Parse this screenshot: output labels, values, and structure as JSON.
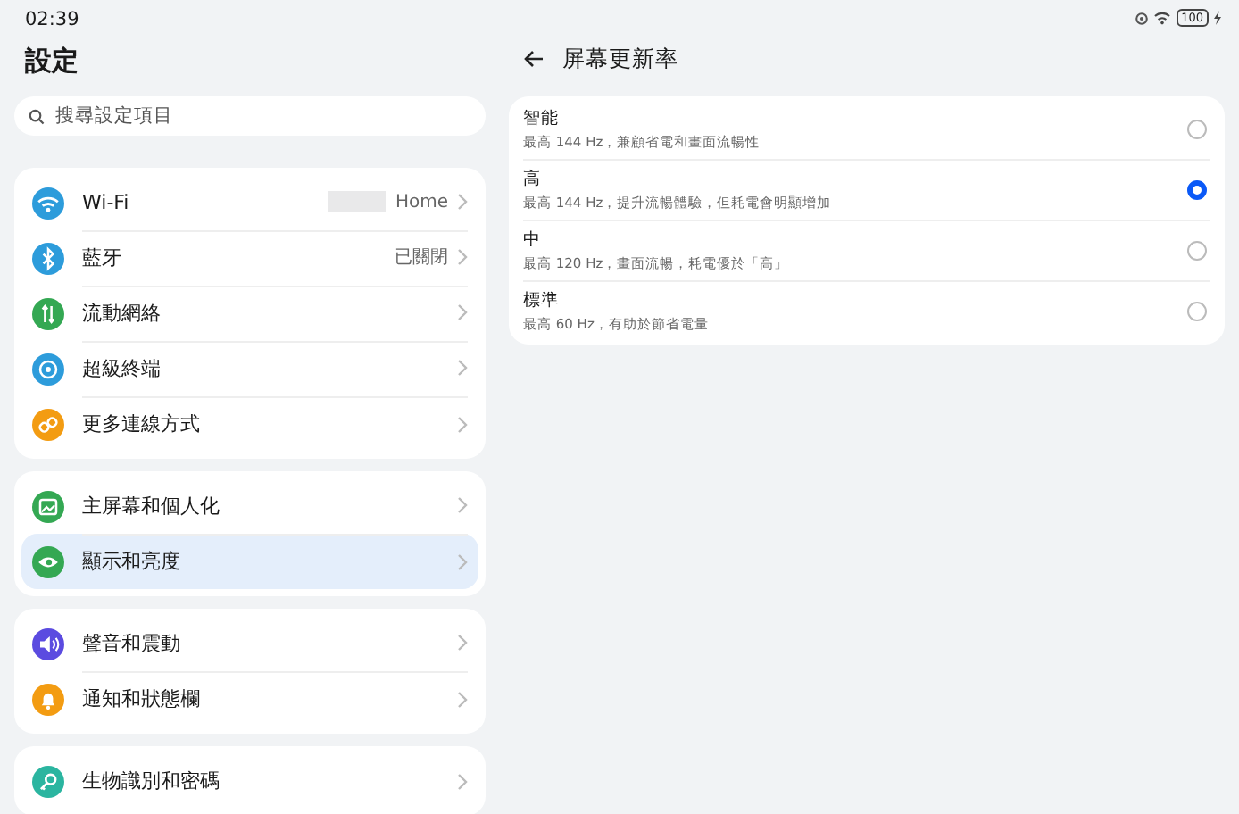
{
  "status_bar": {
    "time": "02:39",
    "battery": "100"
  },
  "sidebar": {
    "title": "設定",
    "search": {
      "placeholder": "搜尋設定項目"
    },
    "groups": [
      {
        "items": [
          {
            "kind": "wifi",
            "label": "Wi-Fi",
            "value": "Home",
            "redacted": true,
            "selected": false
          },
          {
            "kind": "bluetooth",
            "label": "藍牙",
            "value": "已關閉",
            "redacted": false,
            "selected": false
          },
          {
            "kind": "mobile",
            "label": "流動網絡",
            "selected": false
          },
          {
            "kind": "device",
            "label": "超級終端",
            "selected": false
          },
          {
            "kind": "link",
            "label": "更多連線方式",
            "selected": false
          }
        ]
      },
      {
        "items": [
          {
            "kind": "home",
            "label": "主屏幕和個人化",
            "selected": false
          },
          {
            "kind": "eye",
            "label": "顯示和亮度",
            "selected": true
          }
        ]
      },
      {
        "items": [
          {
            "kind": "sound",
            "label": "聲音和震動",
            "selected": false
          },
          {
            "kind": "bell",
            "label": "通知和狀態欄",
            "selected": false
          }
        ]
      },
      {
        "items": [
          {
            "kind": "key",
            "label": "生物識別和密碼",
            "selected": false
          }
        ]
      }
    ]
  },
  "detail": {
    "title": "屏幕更新率",
    "options": [
      {
        "title": "智能",
        "description": "最高 144 Hz，兼顧省電和畫面流暢性",
        "selected": false
      },
      {
        "title": "高",
        "description": "最高 144 Hz，提升流暢體驗，但耗電會明顯增加",
        "selected": true
      },
      {
        "title": "中",
        "description": "最高 120 Hz，畫面流暢，耗電優於「高」",
        "selected": false
      },
      {
        "title": "標準",
        "description": "最高 60 Hz，有助於節省電量",
        "selected": false
      }
    ]
  }
}
